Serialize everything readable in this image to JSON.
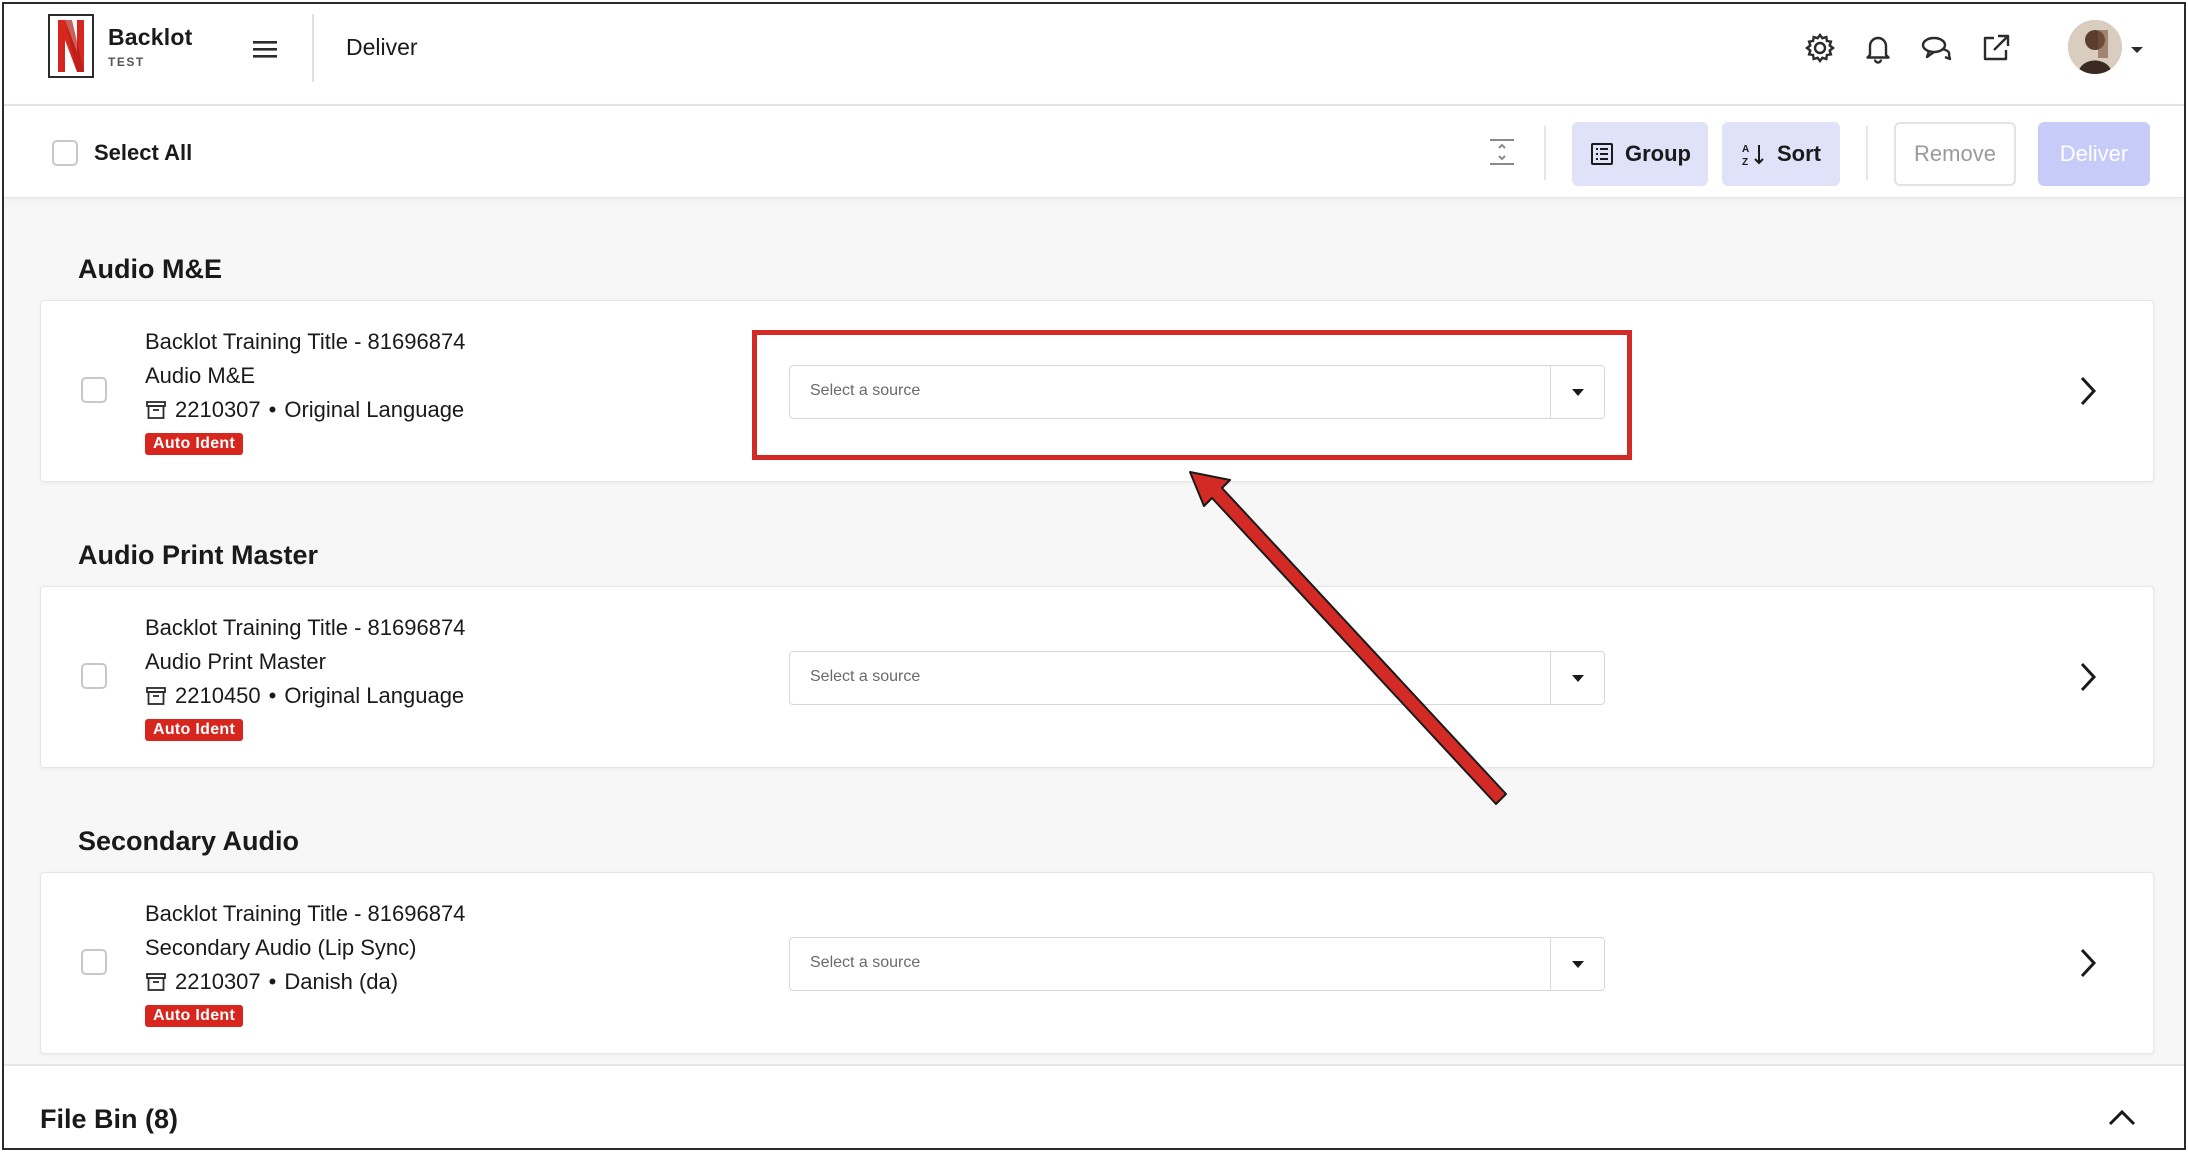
{
  "header": {
    "brand_name": "Backlot",
    "brand_env": "TEST",
    "page_title": "Deliver",
    "icons": [
      "settings-icon",
      "bell-icon",
      "chat-icon",
      "external-link-icon"
    ]
  },
  "toolbar": {
    "select_all_label": "Select All",
    "group_label": "Group",
    "sort_label": "Sort",
    "remove_label": "Remove",
    "deliver_label": "Deliver"
  },
  "sections": [
    {
      "title": "Audio M&E",
      "item": {
        "title": "Backlot Training Title - 81696874",
        "subtitle": "Audio M&E",
        "id": "2210307",
        "language": "Original Language",
        "badge": "Auto Ident",
        "source_placeholder": "Select a source"
      }
    },
    {
      "title": "Audio Print Master",
      "item": {
        "title": "Backlot Training Title - 81696874",
        "subtitle": "Audio Print Master",
        "id": "2210450",
        "language": "Original Language",
        "badge": "Auto Ident",
        "source_placeholder": "Select a source"
      }
    },
    {
      "title": "Secondary Audio",
      "item": {
        "title": "Backlot Training Title - 81696874",
        "subtitle": "Secondary Audio (Lip Sync)",
        "id": "2210307",
        "language": "Danish (da)",
        "badge": "Auto Ident",
        "source_placeholder": "Select a source"
      }
    }
  ],
  "meta_separator": "•",
  "file_bin": {
    "title": "File Bin (8)"
  },
  "colors": {
    "brand_red": "#d7261e",
    "annotation_red": "#d32a26",
    "button_tint": "#dfe2f8",
    "deliver_disabled": "#c6cbf7"
  }
}
